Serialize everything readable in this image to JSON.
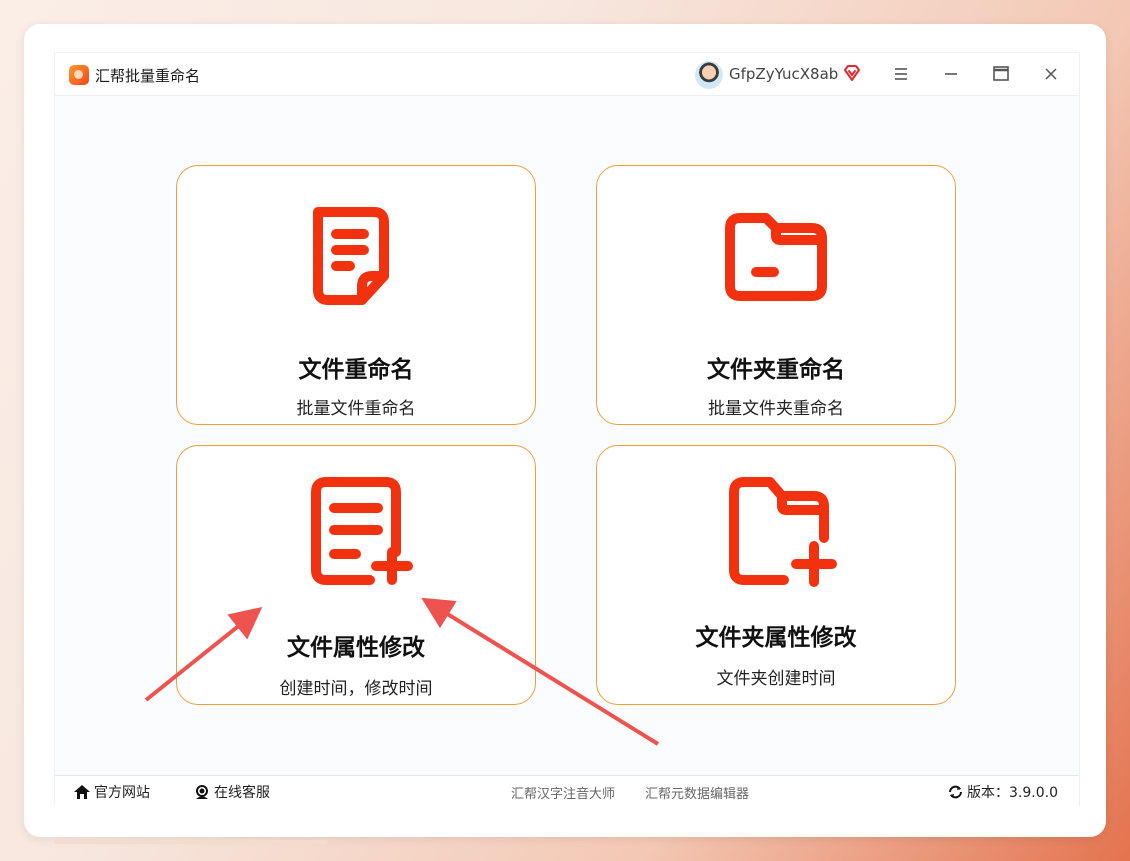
{
  "app": {
    "title": "汇帮批量重命名"
  },
  "user": {
    "name": "GfpZyYucX8ab"
  },
  "tiles": [
    {
      "title": "文件重命名",
      "subtitle": "批量文件重命名",
      "icon": "document-icon"
    },
    {
      "title": "文件夹重命名",
      "subtitle": "批量文件夹重命名",
      "icon": "folder-icon"
    },
    {
      "title": "文件属性修改",
      "subtitle": "创建时间，修改时间",
      "icon": "document-add-icon"
    },
    {
      "title": "文件夹属性修改",
      "subtitle": "文件夹创建时间",
      "icon": "folder-add-icon"
    }
  ],
  "footer": {
    "website_label": "官方网站",
    "service_label": "在线客服",
    "link1": "汇帮汉字注音大师",
    "link2": "汇帮元数据编辑器",
    "version_label": "版本：3.9.0.0"
  },
  "colors": {
    "accent": "#f2320f",
    "tile_border": "#ee9f3d",
    "arrow": "#ef5350"
  }
}
